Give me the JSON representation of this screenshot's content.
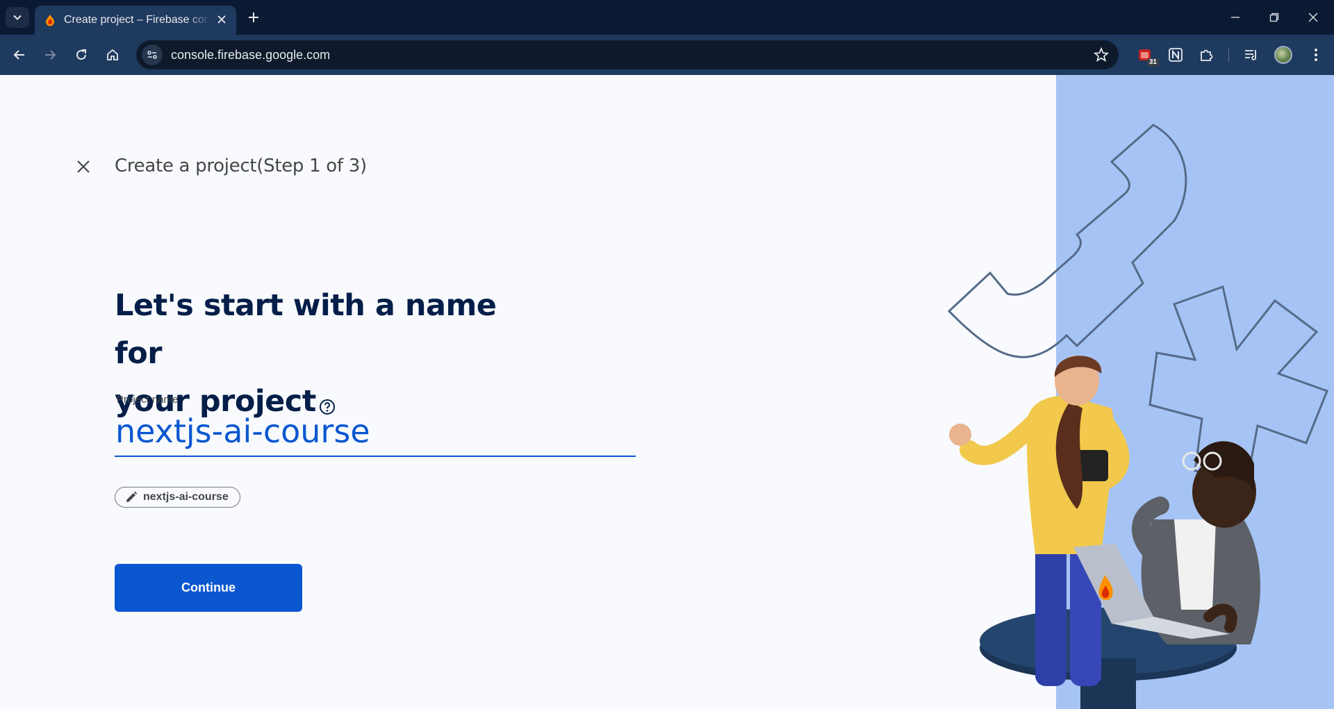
{
  "browser": {
    "tab_title": "Create project – Firebase console",
    "url": "console.firebase.google.com",
    "extension_badge": "31"
  },
  "page": {
    "step_title": "Create a project(Step 1 of 3)",
    "headline_line1": "Let's start with a name for",
    "headline_line2": "your project",
    "project_name_label": "Project name",
    "project_name_value": "nextjs-ai-course",
    "project_id_chip": "nextjs-ai-course",
    "continue_label": "Continue"
  },
  "colors": {
    "primary": "#0b57d0",
    "headline": "#041e49",
    "illustration_panel": "#a5c4f5",
    "browser_frame": "#0b1a33"
  }
}
